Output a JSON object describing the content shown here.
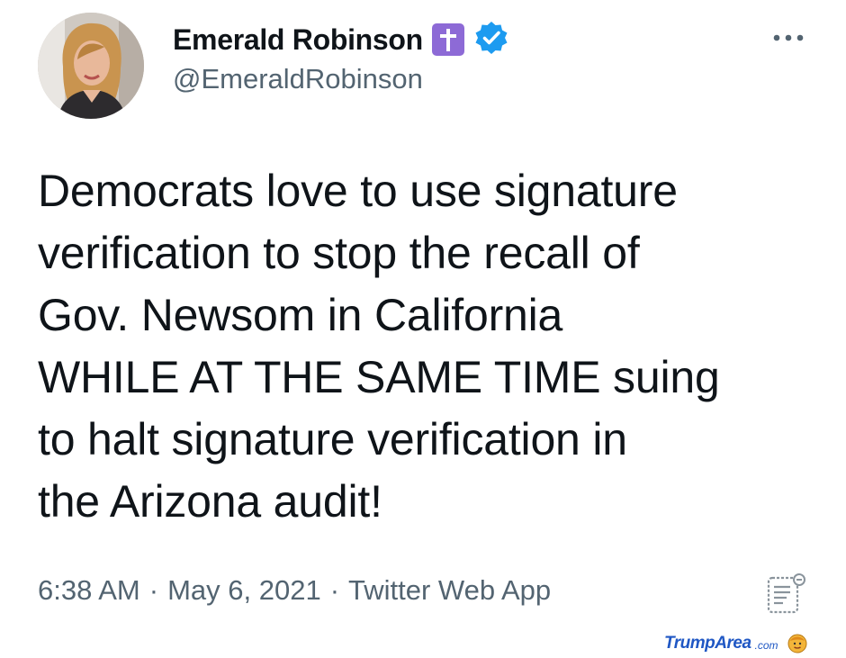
{
  "tweet": {
    "author": {
      "display_name": "Emerald Robinson",
      "handle": "@EmeraldRobinson",
      "badges": [
        "cross-emoji-icon",
        "verified-badge-icon"
      ]
    },
    "text_lines": [
      "Democrats love to use signature",
      "verification to stop the recall of",
      "Gov. Newsom in California",
      "WHILE AT THE SAME TIME suing",
      "to halt signature verification in",
      "the Arizona audit!"
    ],
    "timestamp": {
      "time": "6:38 AM",
      "separator": "·",
      "date": "May 6, 2021",
      "source": "Twitter Web App"
    }
  },
  "watermark": {
    "brand": "TrumpArea",
    "suffix": ".com"
  },
  "colors": {
    "verified_blue": "#1d9bf0",
    "cross_badge_purple": "#8d6ad6",
    "secondary_text": "#536471",
    "watermark_blue": "#1f57c4"
  }
}
